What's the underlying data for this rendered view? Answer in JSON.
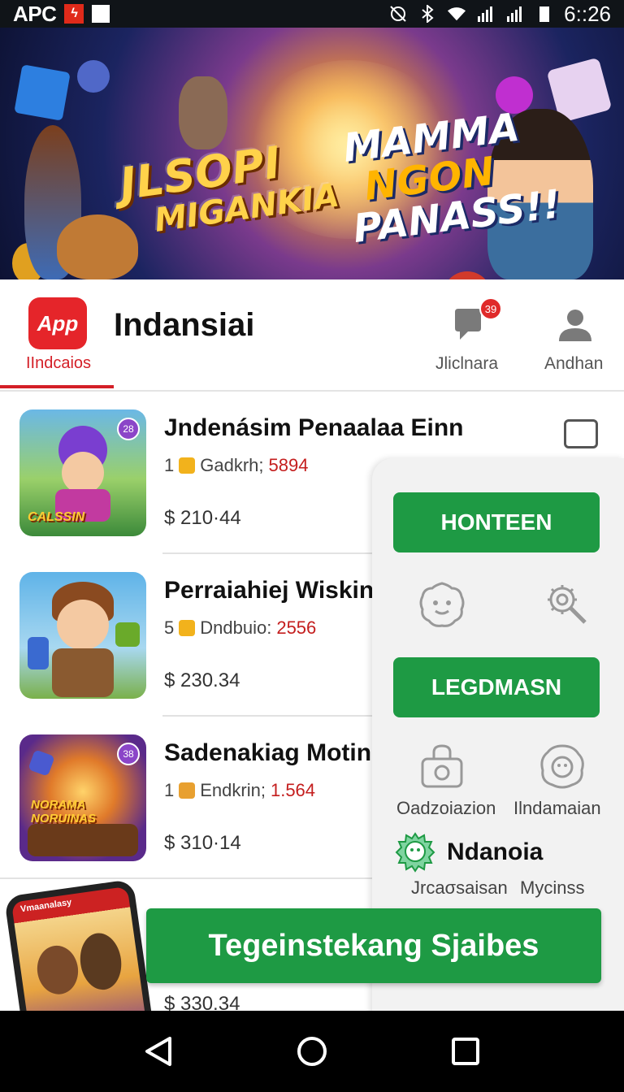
{
  "status_bar": {
    "carrier": "APC",
    "time": "6::26",
    "icons": [
      "red-badge-icon",
      "sim-icon",
      "mute-icon",
      "bluetooth-icon",
      "wifi-icon",
      "signal-icon",
      "signal-icon-2",
      "battery-icon"
    ]
  },
  "banner": {
    "title_left_line1": "JLSOPI",
    "title_left_line2": "MIGANKIA",
    "title_right_line1": "MAMMA",
    "title_right_line2": "NGON",
    "title_right_line3": "PANASS!!"
  },
  "header": {
    "logo_text": "App",
    "logo_label": "IIndcaios",
    "title": "Indansiai",
    "nav_items": [
      {
        "label": "Jliclnara",
        "icon": "chat-icon",
        "badge": "39"
      },
      {
        "label": "Andhan",
        "icon": "profile-icon"
      }
    ],
    "accent": "#d41f27"
  },
  "list": {
    "items": [
      {
        "title": "Jndenásim Penaalaa Einn",
        "meta_prefix": "1",
        "meta_label": "Gadkrh;",
        "meta_value": "5894",
        "price": "$ 210·44",
        "badge": "28",
        "thumb_text": "CALSSIN"
      },
      {
        "title": "Perraiahiej Wiskin",
        "meta_prefix": "5",
        "meta_label": "Dndbuio:",
        "meta_value": "2556",
        "price": "$ 230.34",
        "badge": "",
        "thumb_text": ""
      },
      {
        "title": "Sadenakiag Motin",
        "meta_prefix": "1",
        "meta_label": "Endkrin;",
        "meta_value": "1.564",
        "price": "$ 310·14",
        "badge": "38",
        "thumb_text": "NORAMA NORUINAS"
      }
    ],
    "partial_price": "$ 330.34"
  },
  "panel": {
    "button1": "HONTEEN",
    "button2": "LEGDMASN",
    "icon_row1": [
      "cookie-face-icon",
      "gear-search-icon"
    ],
    "icon_row2": [
      {
        "icon": "lock-camera-icon",
        "label": "Oadzoiazion"
      },
      {
        "icon": "face-blob-icon",
        "label": "Ilndamaian"
      }
    ],
    "brand_icon": "ghost-logo-icon",
    "brand_name": "Ndanoia",
    "footer_left": "Jrcaσsaisan",
    "footer_right": "Mycinss"
  },
  "promo": {
    "phone_brand": "Vmaanalasy",
    "cta": "Tegeinstekang Sjaibes"
  },
  "nav_bar": {
    "icons": [
      "back-icon",
      "home-icon",
      "recents-icon"
    ]
  },
  "colors": {
    "brand_red": "#d41f27",
    "button_green": "#1e9a44",
    "notif_red": "#e02a2a"
  }
}
